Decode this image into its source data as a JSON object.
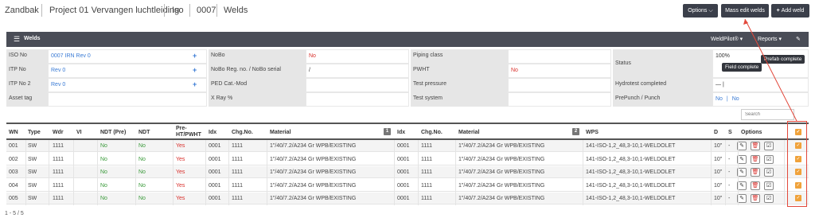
{
  "breadcrumb": {
    "items": [
      "Zandbak",
      "Project 01 Vervangen luchtleiding",
      "Iso",
      "0007",
      "Welds"
    ]
  },
  "toolbar": {
    "options_label": "Options",
    "mass_edit_label": "Mass edit welds",
    "add_weld_label": "Add weld"
  },
  "panel": {
    "title": "Welds",
    "weldpilot_label": "WeldPilot®",
    "reports_label": "Reports"
  },
  "info": {
    "iso_no_label": "ISO No",
    "iso_no_value": "0007 IRN Rev 0",
    "itp_no_label": "ITP No",
    "itp_no_value": "Rev 0",
    "itp_no2_label": "ITP No 2",
    "itp_no2_value": "Rev 0",
    "asset_tag_label": "Asset tag",
    "asset_tag_value": "",
    "nobo_label": "NoBo",
    "nobo_value": "No",
    "nobo_reg_label": "NoBo Reg. no. / NoBo serial",
    "nobo_reg_value": "/",
    "ped_label": "PED Cat.-Mod",
    "ped_value": "",
    "xray_label": "X Ray %",
    "xray_value": "",
    "piping_label": "Piping class",
    "piping_value": "",
    "pwht_label": "PWHT",
    "pwht_value": "No",
    "test_pressure_label": "Test pressure",
    "test_pressure_value": "",
    "test_system_label": "Test system",
    "test_system_value": "",
    "status_label": "Status",
    "status_value": "100%",
    "field_complete_tip": "Field complete",
    "prefab_complete_tip": "Prefab complete",
    "hydro_label": "Hydrotest completed",
    "hydro_value": "— |",
    "prepunch_label": "PrePunch / Punch",
    "prepunch_no1": "No",
    "prepunch_sep": "|",
    "prepunch_no2": "No"
  },
  "search": {
    "placeholder": "Search"
  },
  "table": {
    "headers": {
      "wn": "WN",
      "type": "Type",
      "wdr": "Wdr",
      "vi": "VI",
      "ndt_pre": "NDT (Pre)",
      "ndt": "NDT",
      "pre_ht": "Pre-",
      "pwht": "HT/PWHT",
      "idx": "Idx",
      "chg": "Chg.No.",
      "material": "Material",
      "badge1": "1",
      "idx2": "Idx",
      "chg2": "Chg.No.",
      "material2": "Material",
      "badge2": "2",
      "wps": "WPS",
      "d": "D",
      "s": "S",
      "options": "Options"
    },
    "rows": [
      {
        "wn": "001",
        "type": "SW",
        "wdr": "1111",
        "vi": "",
        "ndt_pre": "No",
        "ndt": "No",
        "pwht": "Yes",
        "idx": "0001",
        "chg": "1111",
        "material": "1\"/40/7.2/A234 Gr WPB/EXISTING",
        "idx2": "0001",
        "chg2": "1111",
        "material2": "1\"/40/7.2/A234 Gr WPB/EXISTING",
        "wps": "141-ISO-1,2_48,3-10,1-WELDOLET",
        "d": "10\"",
        "s": "-"
      },
      {
        "wn": "002",
        "type": "SW",
        "wdr": "1111",
        "vi": "",
        "ndt_pre": "No",
        "ndt": "No",
        "pwht": "Yes",
        "idx": "0001",
        "chg": "1111",
        "material": "1\"/40/7.2/A234 Gr WPB/EXISTING",
        "idx2": "0001",
        "chg2": "1111",
        "material2": "1\"/40/7.2/A234 Gr WPB/EXISTING",
        "wps": "141-ISO-1,2_48,3-10,1-WELDOLET",
        "d": "10\"",
        "s": "-"
      },
      {
        "wn": "003",
        "type": "SW",
        "wdr": "1111",
        "vi": "",
        "ndt_pre": "No",
        "ndt": "No",
        "pwht": "Yes",
        "idx": "0001",
        "chg": "1111",
        "material": "1\"/40/7.2/A234 Gr WPB/EXISTING",
        "idx2": "0001",
        "chg2": "1111",
        "material2": "1\"/40/7.2/A234 Gr WPB/EXISTING",
        "wps": "141-ISO-1,2_48,3-10,1-WELDOLET",
        "d": "10\"",
        "s": "-"
      },
      {
        "wn": "004",
        "type": "SW",
        "wdr": "1111",
        "vi": "",
        "ndt_pre": "No",
        "ndt": "No",
        "pwht": "Yes",
        "idx": "0001",
        "chg": "1111",
        "material": "1\"/40/7.2/A234 Gr WPB/EXISTING",
        "idx2": "0001",
        "chg2": "1111",
        "material2": "1\"/40/7.2/A234 Gr WPB/EXISTING",
        "wps": "141-ISO-1,2_48,3-10,1-WELDOLET",
        "d": "10\"",
        "s": "-"
      },
      {
        "wn": "005",
        "type": "SW",
        "wdr": "1111",
        "vi": "",
        "ndt_pre": "No",
        "ndt": "No",
        "pwht": "Yes",
        "idx": "0001",
        "chg": "1111",
        "material": "1\"/40/7.2/A234 Gr WPB/EXISTING",
        "idx2": "0001",
        "chg2": "1111",
        "material2": "1\"/40/7.2/A234 Gr WPB/EXISTING",
        "wps": "141-ISO-1,2_48,3-10,1-WELDOLET",
        "d": "10\"",
        "s": "-"
      }
    ]
  },
  "footer": {
    "range": "1 - 5 / 5"
  },
  "colors": {
    "accent": "#3b3f4a",
    "checkbox": "#f0a23a",
    "annotation": "#e2483b",
    "link": "#3a7bd5",
    "no_red": "#d9302c",
    "no_green": "#3a9a3a"
  },
  "icons": [
    "chevron-down-icon",
    "plus-icon",
    "list-icon",
    "pencil-icon",
    "trash-icon",
    "check-square-icon"
  ]
}
